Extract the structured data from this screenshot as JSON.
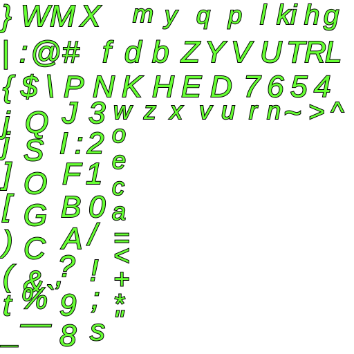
{
  "atlas": {
    "fill_color": "#66ff33",
    "stroke_color": "#000000",
    "background_color": "#ffffff",
    "rows": [
      [
        "}",
        "W",
        "M",
        "X",
        "m",
        "y",
        "q",
        "p",
        "l",
        "k",
        "i",
        "h",
        "g"
      ],
      [
        "|",
        ":",
        "@",
        "#",
        "f",
        "d",
        "b",
        "Z",
        "Y",
        "V",
        "U",
        "T",
        "R",
        "L"
      ],
      [
        "{",
        "$",
        "\\",
        "P",
        "N",
        "K",
        "H",
        "E",
        "D",
        "7",
        "6",
        "5",
        "4"
      ],
      [
        "j",
        "Q",
        "J",
        "3",
        "w",
        "z",
        "x",
        "v",
        "u",
        "r",
        "n",
        "~",
        ">",
        "^"
      ],
      [
        "j",
        "S",
        "I",
        ":",
        "2",
        "o"
      ],
      [
        "]",
        "O",
        "F",
        "1",
        "e"
      ],
      [
        "[",
        "G",
        "B",
        "0",
        "c"
      ],
      [
        ")",
        "C",
        "A",
        "/",
        "a"
      ],
      [
        "(",
        "&",
        ",",
        "?",
        "!",
        "="
      ],
      [
        "t",
        "%",
        "`",
        "9",
        ";",
        "<"
      ],
      [
        "_",
        "—",
        "8",
        "s",
        "+"
      ],
      [
        "*",
        "\""
      ]
    ]
  }
}
